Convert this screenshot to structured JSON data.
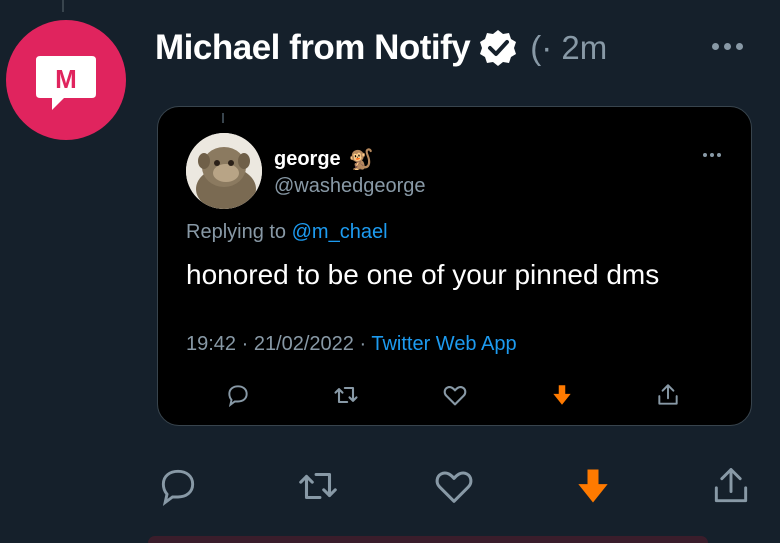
{
  "tweet": {
    "display_name": "Michael from Notify",
    "meta": "(· 2m",
    "avatar_letter": "M"
  },
  "quoted": {
    "name": "george",
    "name_emoji": "🐒",
    "handle": "@washedgeorge",
    "replying_prefix": "Replying to",
    "replying_to": "@m_chael",
    "text": "honored to be one of your pinned dms",
    "timestamp": "19:42 · 21/02/2022 ·",
    "source": "Twitter Web App"
  },
  "colors": {
    "background": "#15202b",
    "accent_blue": "#1d9bf0",
    "muted": "#8899a6",
    "avatar_red": "#e0245e",
    "download_orange": "#ff7a00"
  },
  "icons": [
    "reply-icon",
    "retweet-icon",
    "like-icon",
    "download-icon",
    "share-icon",
    "verified-badge-icon",
    "more-icon"
  ]
}
